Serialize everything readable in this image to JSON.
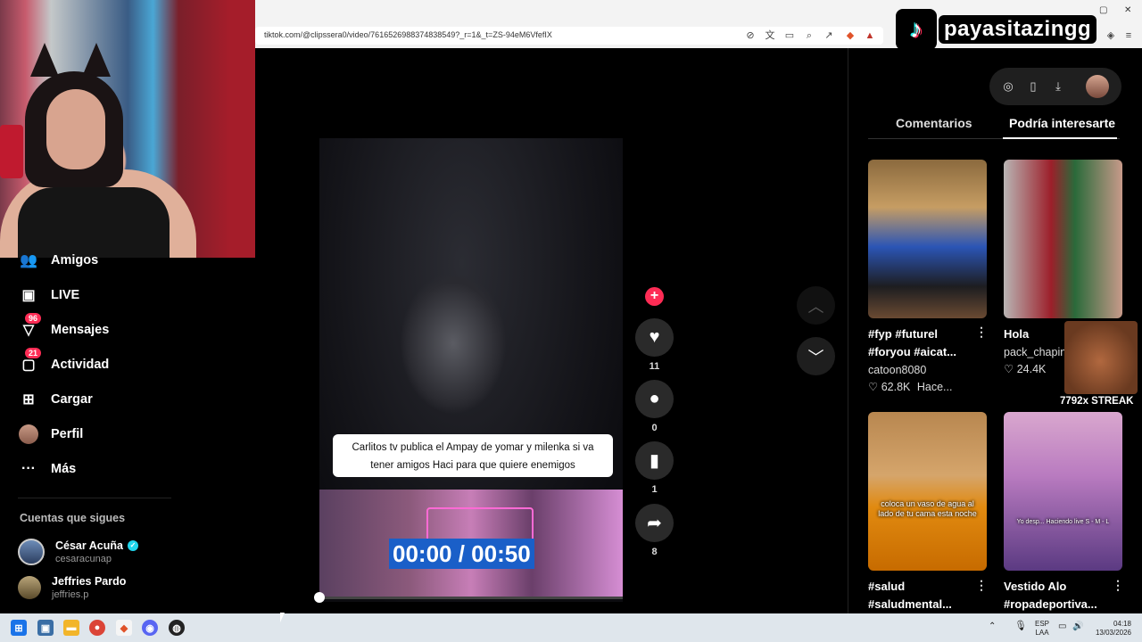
{
  "browser": {
    "url": "tiktok.com/@clipssera0/video/7616526988374838549?_r=1&_t=ZS-94eM6VfefIX"
  },
  "streamer": {
    "name": "payasitazingg",
    "logo_icon": "tiktok-logo-icon"
  },
  "sidebar": {
    "items": [
      {
        "label": "Amigos",
        "icon": "friends-icon"
      },
      {
        "label": "LIVE",
        "icon": "live-icon"
      },
      {
        "label": "Mensajes",
        "icon": "messages-icon",
        "badge": "96"
      },
      {
        "label": "Actividad",
        "icon": "activity-icon",
        "badge": "21"
      },
      {
        "label": "Cargar",
        "icon": "upload-icon"
      },
      {
        "label": "Perfil",
        "icon": "profile-avatar"
      },
      {
        "label": "Más",
        "icon": "more-icon"
      }
    ],
    "following_label": "Cuentas que sigues",
    "following": [
      {
        "name": "César Acuña",
        "username": "cesaracunap",
        "verified": true
      },
      {
        "name": "Jeffries Pardo",
        "username": "jeffries.p",
        "verified": false
      }
    ]
  },
  "video": {
    "caption": "Carlitos tv publica el Ampay de yomar y milenka si va tener amigos Haci para que quiere enemigos",
    "timecode": "00:00 / 00:50",
    "progress": 0
  },
  "actions": {
    "likes": "11",
    "comments": "0",
    "saves": "1",
    "shares": "8"
  },
  "right_panel": {
    "tabs": [
      {
        "label": "Comentarios",
        "active": false
      },
      {
        "label": "Podría interesarte",
        "active": true
      }
    ],
    "cards": [
      {
        "title": "#fyp #futurel #foryou #aicat...",
        "user": "catoon8080",
        "likes": "62.8K",
        "time": "Hace..."
      },
      {
        "title": "Hola",
        "user": "pack_chapin",
        "likes": "24.4K",
        "time": ""
      },
      {
        "title": "#salud #saludmental...",
        "img_text": "coloca un vaso de agua al lado de tu cama esta noche"
      },
      {
        "title": "Vestido Alo #ropadeportiva...",
        "img_text": "Yo desp... Haciendo live S - M - L"
      }
    ]
  },
  "meme": {
    "streak": "7792x STREAK"
  },
  "taskbar": {
    "lang_top": "ESP",
    "lang_bottom": "LAA",
    "time": "04:18",
    "date": "13/03/2026"
  },
  "colors": {
    "accent": "#fe2c55",
    "timecode_bg": "#1a5fc8"
  }
}
